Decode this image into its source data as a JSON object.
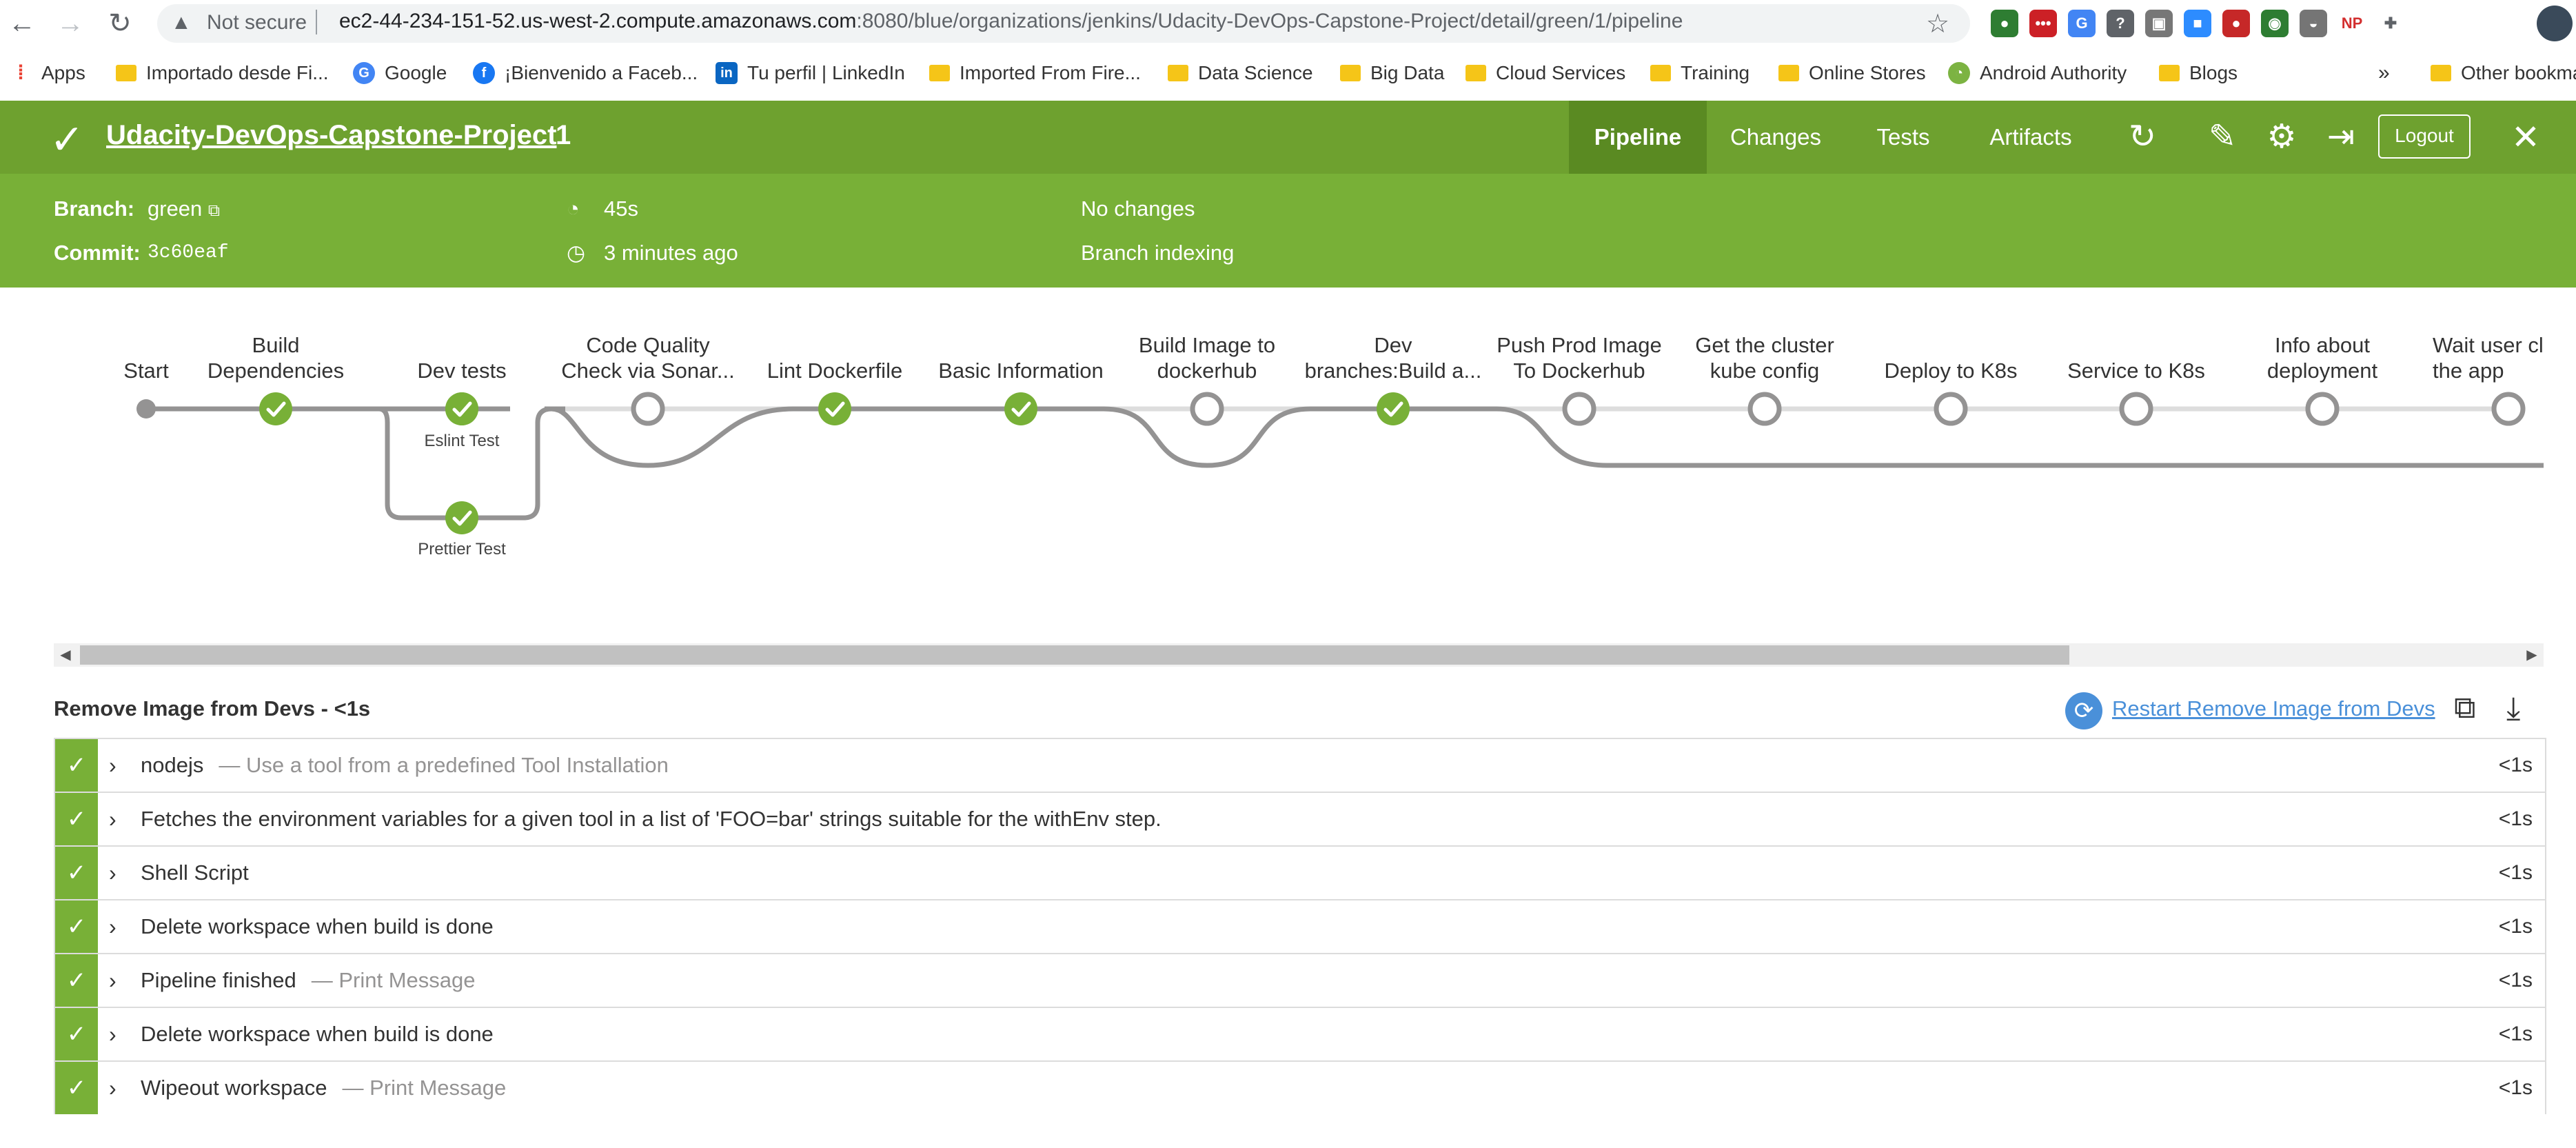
{
  "browser": {
    "security_label": "Not secure",
    "url_host": "ec2-44-234-151-52.us-west-2.compute.amazonaws.com",
    "url_path": ":8080/blue/organizations/jenkins/Udacity-DevOps-Capstone-Project/detail/green/1/pipeline",
    "bookmarks": [
      {
        "label": "Apps",
        "icon": "apps-grid-icon"
      },
      {
        "label": "Importado desde Fi...",
        "icon": "folder-icon"
      },
      {
        "label": "Google",
        "icon": "google-icon"
      },
      {
        "label": "¡Bienvenido a Faceb...",
        "icon": "facebook-icon"
      },
      {
        "label": "Tu perfil | LinkedIn",
        "icon": "linkedin-icon"
      },
      {
        "label": "Imported From Fire...",
        "icon": "folder-icon"
      },
      {
        "label": "Data Science",
        "icon": "folder-icon"
      },
      {
        "label": "Big Data",
        "icon": "folder-icon"
      },
      {
        "label": "Cloud Services",
        "icon": "folder-icon"
      },
      {
        "label": "Training",
        "icon": "folder-icon"
      },
      {
        "label": "Online Stores",
        "icon": "folder-icon"
      },
      {
        "label": "Android Authority",
        "icon": "android-icon"
      },
      {
        "label": "Blogs",
        "icon": "folder-icon"
      }
    ],
    "bookmarks_overflow": "»",
    "other_bookmarks": "Other bookmarks",
    "extensions": [
      {
        "icon": "globe-extension-icon",
        "color": "#2e7d32",
        "glyph": "●"
      },
      {
        "icon": "lastpass-extension-icon",
        "color": "#cc2026",
        "glyph": "•••"
      },
      {
        "icon": "translate-extension-icon",
        "color": "#4285f4",
        "glyph": "G"
      },
      {
        "icon": "keep-extension-icon",
        "color": "#5f6368",
        "glyph": "?"
      },
      {
        "icon": "window-extension-icon",
        "color": "#777777",
        "glyph": "▣"
      },
      {
        "icon": "zoom-extension-icon",
        "color": "#2d8cff",
        "glyph": "■"
      },
      {
        "icon": "record-extension-icon",
        "color": "#c62828",
        "glyph": "●"
      },
      {
        "icon": "green-extension-icon",
        "color": "#2e7d32",
        "glyph": "◉"
      },
      {
        "icon": "scale-extension-icon",
        "color": "#757575",
        "glyph": "◒"
      },
      {
        "icon": "np-extension-icon",
        "color": "#ffffff",
        "glyph": "NP",
        "text_color": "#d32f2f"
      },
      {
        "icon": "puzzle-extension-icon",
        "color": "#ffffff",
        "glyph": "✚",
        "text_color": "#5f6368"
      }
    ]
  },
  "header": {
    "project": "Udacity-DevOps-Capstone-Project",
    "run": "1",
    "tabs": [
      "Pipeline",
      "Changes",
      "Tests",
      "Artifacts"
    ],
    "logout": "Logout",
    "branch_label": "Branch:",
    "branch": "green",
    "commit_label": "Commit:",
    "commit": "3c60eaf",
    "duration": "45s",
    "ago": "3 minutes ago",
    "changes": "No changes",
    "cause": "Branch indexing"
  },
  "pipeline": {
    "stages": [
      {
        "label": "Start",
        "status": "start"
      },
      {
        "label": "Build\nDependencies",
        "status": "success"
      },
      {
        "label": "Dev tests",
        "status": "success"
      },
      {
        "label": "Code Quality\nCheck via Sonar...",
        "status": "skipped"
      },
      {
        "label": "Lint Dockerfile",
        "status": "success"
      },
      {
        "label": "Basic Information",
        "status": "success"
      },
      {
        "label": "Build Image to\ndockerhub",
        "status": "skipped"
      },
      {
        "label": "Dev\nbranches:Build a...",
        "status": "success"
      },
      {
        "label": "Push Prod Image\nTo Dockerhub",
        "status": "skipped"
      },
      {
        "label": "Get the cluster\nkube config",
        "status": "skipped"
      },
      {
        "label": "Deploy to K8s",
        "status": "skipped"
      },
      {
        "label": "Service to K8s",
        "status": "skipped"
      },
      {
        "label": "Info about\ndeployment",
        "status": "skipped"
      },
      {
        "label": "Wait user cl\nthe app",
        "status": "skipped"
      }
    ],
    "parallel": [
      {
        "label": "Eslint Test",
        "status": "success"
      },
      {
        "label": "Prettier Test",
        "status": "success"
      }
    ]
  },
  "log": {
    "title": "Remove Image from Devs - <1s",
    "restart": "Restart Remove Image from Devs",
    "steps": [
      {
        "name": "nodejs",
        "sub": "— Use a tool from a predefined Tool Installation",
        "duration": "<1s"
      },
      {
        "name": "Fetches the environment variables for a given tool in a list of 'FOO=bar' strings suitable for the withEnv step.",
        "sub": "",
        "duration": "<1s"
      },
      {
        "name": "Shell Script",
        "sub": "",
        "duration": "<1s"
      },
      {
        "name": "Delete workspace when build is done",
        "sub": "",
        "duration": "<1s"
      },
      {
        "name": "Pipeline finished",
        "sub": "— Print Message",
        "duration": "<1s"
      },
      {
        "name": "Delete workspace when build is done",
        "sub": "",
        "duration": "<1s"
      },
      {
        "name": "Wipeout workspace",
        "sub": "— Print Message",
        "duration": "<1s"
      }
    ]
  }
}
